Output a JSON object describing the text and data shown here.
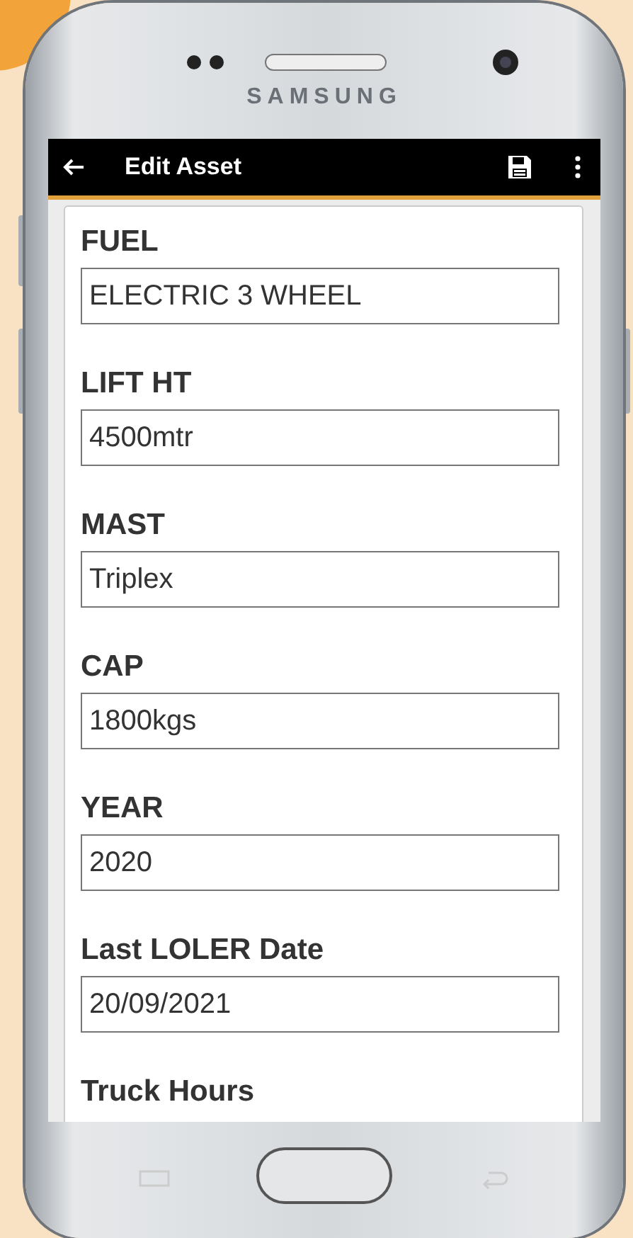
{
  "device": {
    "brand": "SAMSUNG"
  },
  "app_bar": {
    "title": "Edit Asset"
  },
  "fields": [
    {
      "label": "FUEL",
      "value": "ELECTRIC 3 WHEEL"
    },
    {
      "label": "LIFT HT",
      "value": "4500mtr"
    },
    {
      "label": "MAST",
      "value": "Triplex"
    },
    {
      "label": "CAP",
      "value": "1800kgs"
    },
    {
      "label": "YEAR",
      "value": "2020"
    },
    {
      "label": "Last LOLER Date",
      "value": "20/09/2021"
    },
    {
      "label": "Truck Hours"
    }
  ]
}
